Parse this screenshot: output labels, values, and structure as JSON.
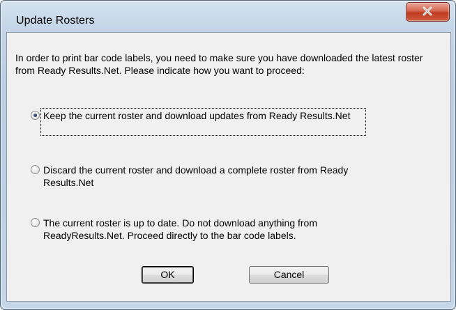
{
  "window": {
    "title": "Update Rosters",
    "close_icon": "close-icon"
  },
  "dialog": {
    "intro": "In order to print bar code labels, you need to make sure you have downloaded the latest roster from Ready Results.Net. Please indicate how you want to proceed:",
    "options": [
      {
        "label": "Keep the current roster and download updates from Ready Results.Net",
        "selected": true
      },
      {
        "label": "Discard the current roster and download a complete roster from Ready Results.Net",
        "selected": false
      },
      {
        "label": "The current roster is up to date. Do not download anything from ReadyResults.Net. Proceed directly to the bar code labels.",
        "selected": false
      }
    ],
    "ok_label": "OK",
    "cancel_label": "Cancel"
  },
  "colors": {
    "close_button": "#c8452a",
    "client_bg": "#f0f0f0",
    "frame": "#bcd0e4"
  }
}
